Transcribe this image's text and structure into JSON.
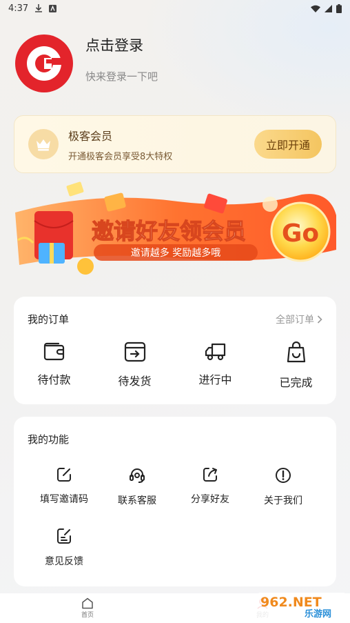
{
  "status": {
    "time": "4:37"
  },
  "profile": {
    "login_title": "点击登录",
    "login_sub": "快来登录一下吧"
  },
  "vip": {
    "title": "极客会员",
    "subtitle": "开通极客会员享受8大特权",
    "button": "立即开通"
  },
  "banner": {
    "title": "邀请好友领会员",
    "subtitle": "邀请越多 奖励越多哦",
    "go": "Go"
  },
  "orders": {
    "title": "我的订单",
    "more": "全部订单",
    "items": [
      {
        "label": "待付款",
        "icon": "wallet-icon"
      },
      {
        "label": "待发货",
        "icon": "box-ship-icon"
      },
      {
        "label": "进行中",
        "icon": "truck-icon"
      },
      {
        "label": "已完成",
        "icon": "bag-done-icon"
      }
    ]
  },
  "functions": {
    "title": "我的功能",
    "items": [
      {
        "label": "填写邀请码",
        "icon": "edit-icon"
      },
      {
        "label": "联系客服",
        "icon": "headset-icon"
      },
      {
        "label": "分享好友",
        "icon": "share-icon"
      },
      {
        "label": "关于我们",
        "icon": "info-icon"
      },
      {
        "label": "意见反馈",
        "icon": "feedback-icon"
      }
    ]
  },
  "tabbar": {
    "home": "首页",
    "mine": "我的"
  },
  "watermark": {
    "site": "962.NET",
    "name": "乐游网"
  },
  "colors": {
    "brand_red": "#e3242b",
    "gold": "#f4c560",
    "banner_orange": "#ff6a2a"
  }
}
